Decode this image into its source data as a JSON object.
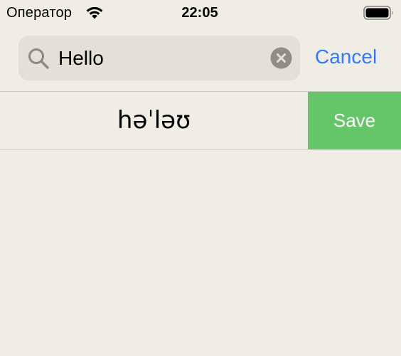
{
  "status_bar": {
    "carrier": "Оператор",
    "time": "22:05",
    "wifi_icon": "wifi-icon",
    "battery_icon": "battery-icon"
  },
  "search": {
    "query": "Hello",
    "search_icon": "search-icon",
    "clear_icon": "clear-icon",
    "cancel_label": "Cancel"
  },
  "result": {
    "transcription": "həˈləʊ",
    "save_label": "Save"
  },
  "colors": {
    "background": "#f0ede6",
    "search_field": "#e2e0d9",
    "accent_blue": "#3479f6",
    "save_green": "#64c668"
  }
}
